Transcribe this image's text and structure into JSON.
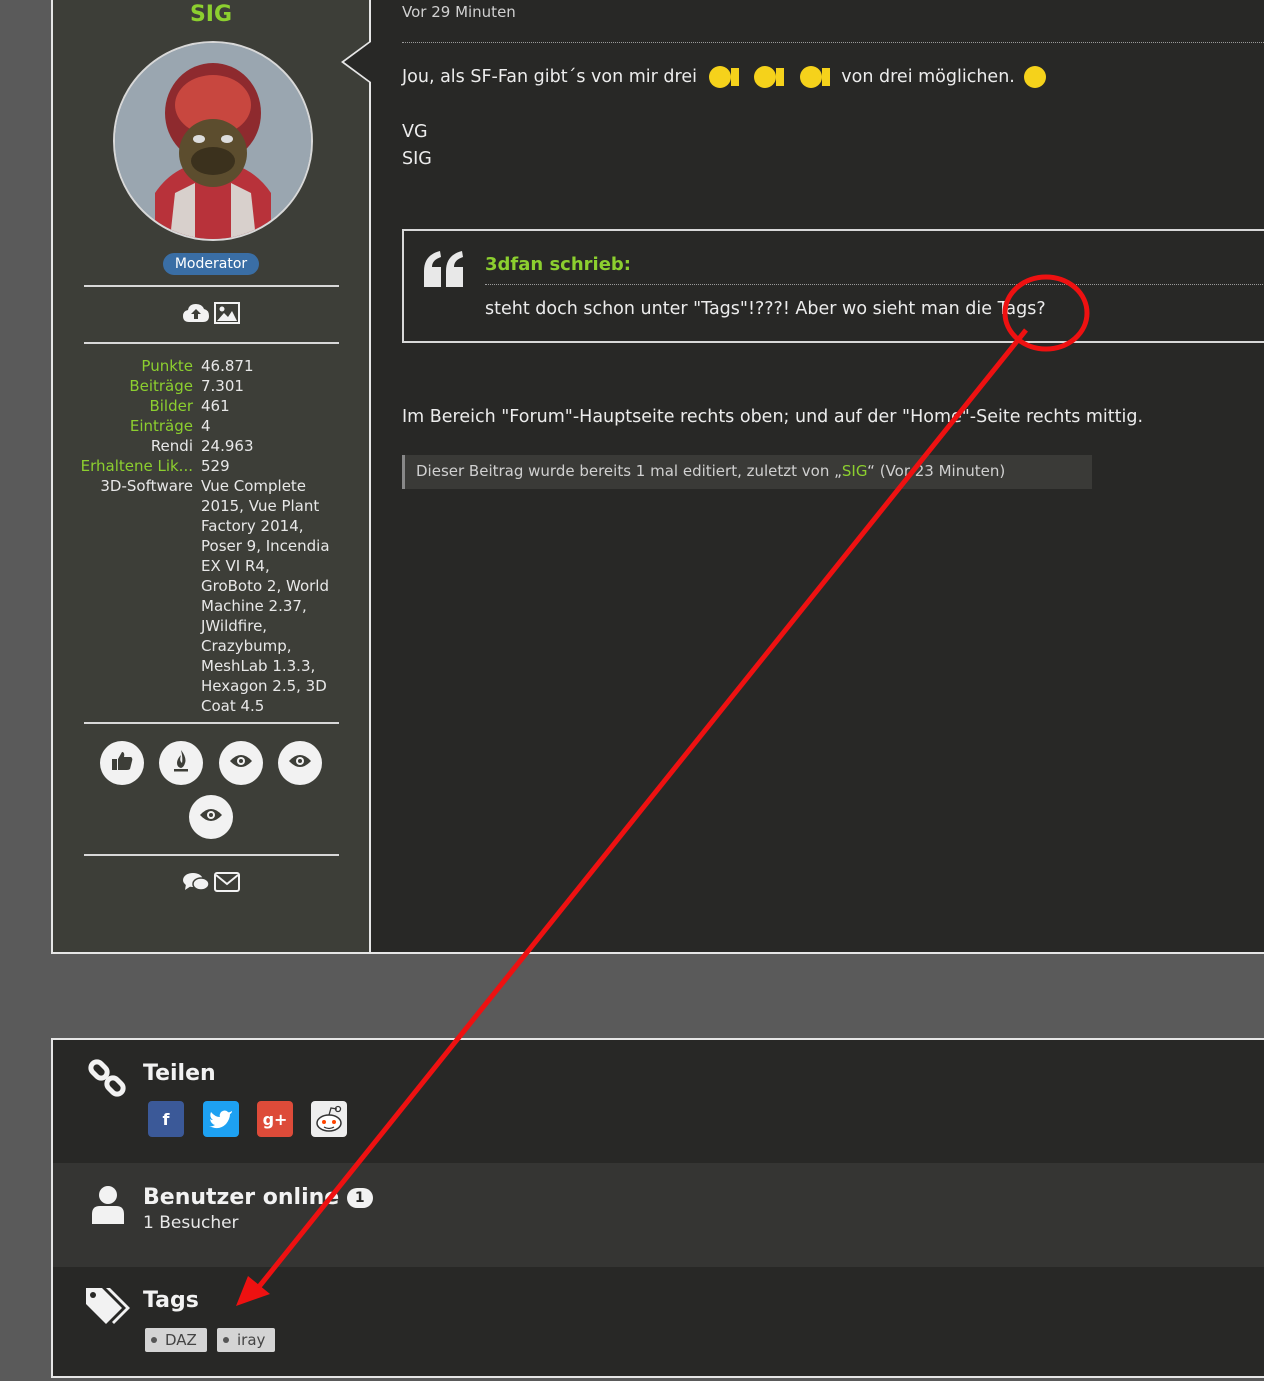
{
  "sidebar": {
    "username": "SIG",
    "role_badge": "Moderator",
    "stats": [
      {
        "label": "Punkte",
        "value": "46.871"
      },
      {
        "label": "Beiträge",
        "value": "7.301"
      },
      {
        "label": "Bilder",
        "value": "461"
      },
      {
        "label": "Einträge",
        "value": "4"
      },
      {
        "label": "Rendi",
        "value": "24.963"
      },
      {
        "label": "Erhaltene Lik...",
        "value": "529"
      },
      {
        "label": "3D-Software",
        "value": "Vue Complete 2015, Vue Plant Factory 2014, Poser 9, Incendia EX VI R4, GroBoto 2, World Machine 2.37, JWildfire, Crazybump, MeshLab 1.3.3, Hexagon 2.5, 3D Coat 4.5"
      }
    ]
  },
  "post": {
    "timestamp": "Vor 29 Minuten",
    "line1_a": "Jou, als SF-Fan gibt´s von mir drei",
    "line1_b": "von drei möglichen.",
    "line2": "VG",
    "line3": "SIG",
    "quote": {
      "author": "3dfan schrieb:",
      "text": "steht doch schon unter \"Tags\"!???! Aber wo sieht man die Tags?"
    },
    "answer": "Im Bereich \"Forum\"-Hauptseite rechts oben; und auf der \"Home\"-Seite rechts mittig.",
    "edit_note_a": "Dieser Beitrag wurde bereits 1 mal editiert, zuletzt von „",
    "edit_note_user": "SIG",
    "edit_note_b": "“ (Vor 23 Minuten)"
  },
  "share": {
    "title": "Teilen"
  },
  "online": {
    "title": "Benutzer online",
    "count": "1",
    "subtitle": "1 Besucher"
  },
  "tags": {
    "title": "Tags",
    "items": [
      "DAZ",
      "iray"
    ]
  },
  "colors": {
    "accent": "#8ccf2f",
    "annotation": "#ee1111"
  }
}
